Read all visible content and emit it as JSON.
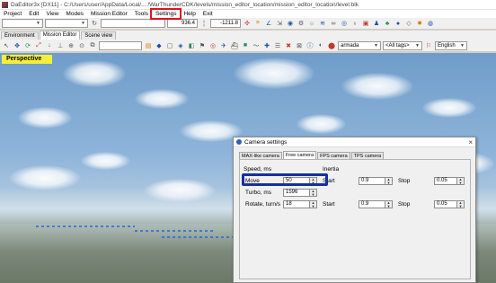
{
  "window": {
    "title": "DaEditor3x [DX11] - C:/Users/user/AppData/Local/... /WarThunderCDK/levels/mission_editor_location/mission_editor_location/level.blk"
  },
  "menu": {
    "items": [
      "Project",
      "Edit",
      "View",
      "Modes",
      "Mission Editor",
      "Tools",
      "Settings",
      "Help",
      "Exit"
    ],
    "highlighted": "Settings",
    "highlight_color": "#e0141e"
  },
  "toolbar": {
    "x_value": "936.4",
    "z_value": "-1211.8"
  },
  "tabs": [
    "Environment",
    "Mission Editor",
    "Scene view"
  ],
  "active_tab": "Mission Editor",
  "toolbar2": {
    "layer_select": "armada",
    "tags_select": "<All tags>",
    "language_select": "English"
  },
  "viewport": {
    "label": "Perspective",
    "label_color": "#f5ef3c"
  },
  "camera_dialog": {
    "title": "Camera settings",
    "tabs": [
      "MAX-like camera",
      "Free camera",
      "FPS camera",
      "TPS camera"
    ],
    "active_tab": "Free camera",
    "speed_header": "Speed, ms",
    "inertia_header": "Inertia",
    "rows": [
      {
        "label": "Move",
        "value": "50",
        "start_label": "Start",
        "start_value": "0.9",
        "stop_label": "Stop",
        "stop_value": "0.05"
      },
      {
        "label": "Turbo, ms",
        "value": "1596"
      },
      {
        "label": "Rotate, turn/s",
        "value": "18",
        "start_label": "Start",
        "start_value": "0.9",
        "stop_label": "Stop",
        "stop_value": "0.05"
      }
    ],
    "highlight_color": "#142fa3"
  }
}
